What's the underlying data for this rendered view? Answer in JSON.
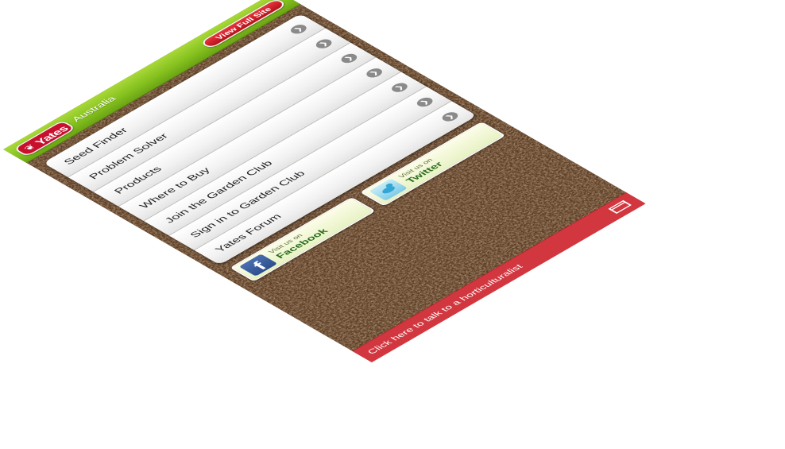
{
  "header": {
    "brand": "Yates",
    "region": "Australia",
    "full_site_label": "View Full Site"
  },
  "menu": {
    "items": [
      {
        "label": "Seed Finder"
      },
      {
        "label": "Problem Solver"
      },
      {
        "label": "Products"
      },
      {
        "label": "Where to Buy"
      },
      {
        "label": "Join the Garden Club"
      },
      {
        "label": "Sign in to Garden Club"
      },
      {
        "label": "Yates Forum"
      }
    ],
    "arrow_icon": "chevron-right-circle-icon"
  },
  "social": {
    "facebook": {
      "small": "Visit us on",
      "big": "Facebook",
      "icon": "facebook-icon"
    },
    "twitter": {
      "small": "Visit us on",
      "big": "Twitter",
      "icon": "twitter-bird-icon"
    }
  },
  "footer": {
    "text": "Click here to talk to a horticulturalist",
    "icon": "window-icon"
  },
  "colors": {
    "header_green": "#86c21f",
    "brand_red": "#c8102e",
    "footer_red": "#d2373f",
    "soil_brown": "#5a3b22"
  }
}
